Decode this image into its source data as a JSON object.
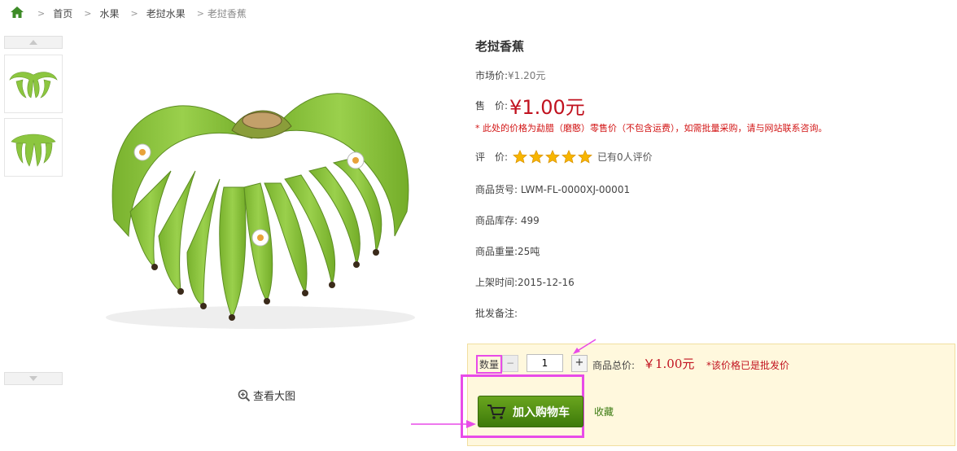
{
  "breadcrumb": {
    "items": [
      "首页",
      "水果",
      "老挝水果",
      "老挝香蕉"
    ]
  },
  "gallery": {
    "view_large": "查看大图"
  },
  "product": {
    "title": "老挝香蕉",
    "market_price_label": "市场价:",
    "market_price": "¥1.20元",
    "sale_price_label": "售　价:",
    "sale_price": "¥1.00元",
    "price_note": "* 此处的价格为勐腊（磨憨）零售价（不包含运费），如需批量采购，请与网站联系咨询。",
    "rating_label": "评　价:",
    "rating_stars": 5,
    "rating_count_text": "已有0人评价",
    "sku_label": "商品货号:",
    "sku": "LWM-FL-0000XJ-00001",
    "stock_label": "商品库存:",
    "stock": "499",
    "weight_label": "商品重量:",
    "weight": "25吨",
    "onshelf_label": "上架时间:",
    "onshelf": "2015-12-16",
    "remark_label": "批发备注:"
  },
  "buy": {
    "qty_label": "数量",
    "minus": "−",
    "qty_value": "1",
    "plus": "+",
    "total_label": "商品总价:",
    "total_value": "￥1.00元",
    "wholesale_note": "*该价格已是批发价",
    "add_to_cart": "加入购物车",
    "favorite": "收藏"
  },
  "colors": {
    "price_red": "#c1121f",
    "buy_box_bg": "#fff8dd",
    "button_green": "#4f8e12",
    "annotation_magenta": "#e84be8"
  },
  "icons": [
    "home-icon",
    "chevron-right-icon",
    "arrow-up-icon",
    "arrow-down-icon",
    "zoom-in-icon",
    "star-icon",
    "cart-icon"
  ]
}
